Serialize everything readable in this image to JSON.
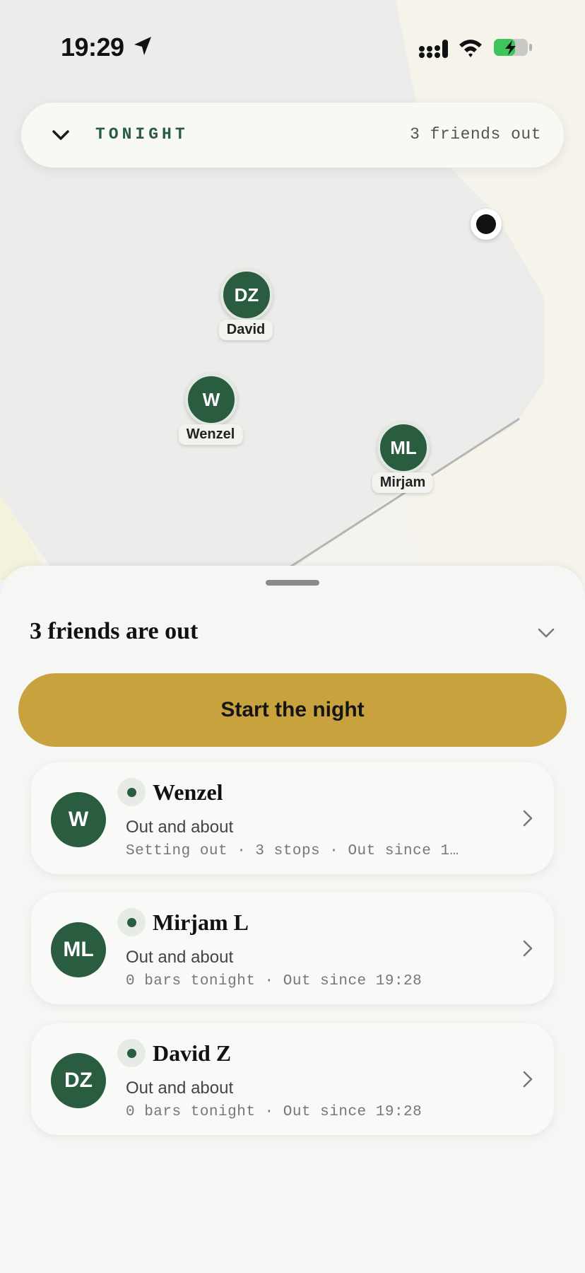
{
  "status_bar": {
    "time": "19:29"
  },
  "header": {
    "title": "TONIGHT",
    "count_text": "3 friends out"
  },
  "map": {
    "markers": [
      {
        "initials": "DZ",
        "label": "David"
      },
      {
        "initials": "W",
        "label": "Wenzel"
      },
      {
        "initials": "ML",
        "label": "Mirjam"
      }
    ]
  },
  "sheet": {
    "title": "3 friends are out",
    "start_label": "Start the night",
    "friends": [
      {
        "initials": "W",
        "name": "Wenzel",
        "status": "Out and about",
        "meta": "Setting out · 3 stops · Out since 1…"
      },
      {
        "initials": "ML",
        "name": "Mirjam L",
        "status": "Out and about",
        "meta": "0 bars tonight · Out since 19:28"
      },
      {
        "initials": "DZ",
        "name": "David Z",
        "status": "Out and about",
        "meta": "0 bars tonight · Out since 19:28"
      }
    ]
  },
  "colors": {
    "accent": "#2a5c3f",
    "button": "#c8a23c",
    "sheet_bg": "#f6f7f4"
  },
  "icons": [
    "location-arrow-icon",
    "signal-icon",
    "wifi-icon",
    "battery-icon",
    "chevron-down-icon",
    "chevron-right-icon"
  ]
}
